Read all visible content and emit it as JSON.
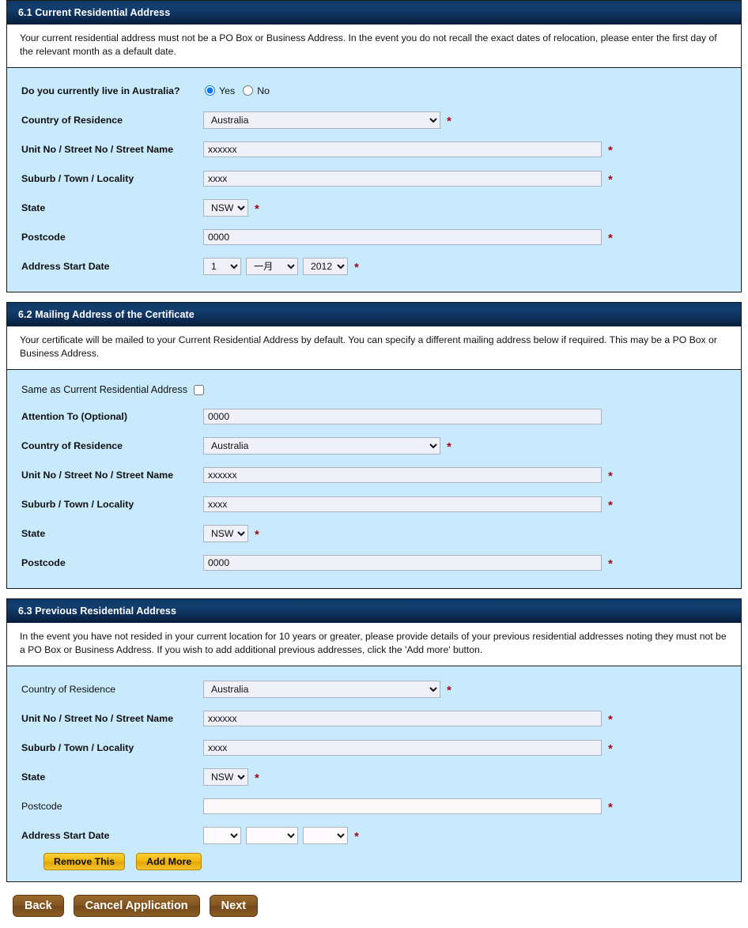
{
  "sections": [
    {
      "id": "current-residential-address",
      "title": "6.1 Current Residential Address",
      "note": "Your current residential address must not be a PO Box or Business Address. In the event you do not recall the exact dates of relocation, please enter the first day of the relevant month as a default date.",
      "live_in_australia_label": "Do you currently live in Australia?",
      "radio_yes": "Yes",
      "radio_no": "No",
      "radio_selected": "Yes",
      "labels": {
        "country": "Country of Residence",
        "unit": "Unit No / Street No / Street Name",
        "suburb": "Suburb / Town / Locality",
        "state": "State",
        "postcode": "Postcode",
        "start_date": "Address Start Date"
      },
      "values": {
        "country": "Australia",
        "unit": "xxxxxx",
        "suburb": "xxxx",
        "state": "NSW",
        "postcode": "0000",
        "day": "1",
        "month": "一月",
        "year": "2012"
      }
    },
    {
      "id": "mailing-address-of-the-certificate",
      "title": "6.2 Mailing Address of the Certificate",
      "note": "Your certificate will be mailed to your Current Residential Address by default. You can specify a different mailing address below if required. This may be a PO Box or Business Address.",
      "same_as_label": "Same as Current Residential Address",
      "same_as_checked": false,
      "labels": {
        "attention": "Attention To (Optional)",
        "country": "Country of Residence",
        "unit": "Unit No / Street No / Street Name",
        "suburb": "Suburb / Town / Locality",
        "state": "State",
        "postcode": "Postcode"
      },
      "values": {
        "attention": "0000",
        "country": "Australia",
        "unit": "xxxxxx",
        "suburb": "xxxx",
        "state": "NSW",
        "postcode": "0000"
      }
    },
    {
      "id": "previous-residential-address",
      "title": "6.3 Previous Residential Address",
      "note": "In the event you have not resided in your current location for 10 years or greater, please provide details of your previous residential addresses noting they must not be a PO Box or Business Address. If you wish to add additional previous addresses, click the 'Add more' button.",
      "labels": {
        "country": "Country of Residence",
        "unit": "Unit No / Street No / Street Name",
        "suburb": "Suburb / Town / Locality",
        "state": "State",
        "postcode": "Postcode",
        "start_date": "Address Start Date"
      },
      "values": {
        "country": "Australia",
        "unit": "xxxxxx",
        "suburb": "xxxx",
        "state": "NSW",
        "postcode": "",
        "day": "",
        "month": "",
        "year": ""
      },
      "remove_button": "Remove This",
      "add_button": "Add More"
    }
  ],
  "nav": {
    "back": "Back",
    "cancel": "Cancel Application",
    "next": "Next"
  },
  "required_marker": "*",
  "colors": {
    "header_blue": "#0d2c53",
    "body_blue": "#c8eafc",
    "required_red": "#9d0b19",
    "gold_button": "#f2b609",
    "brown_button": "#81541f"
  }
}
